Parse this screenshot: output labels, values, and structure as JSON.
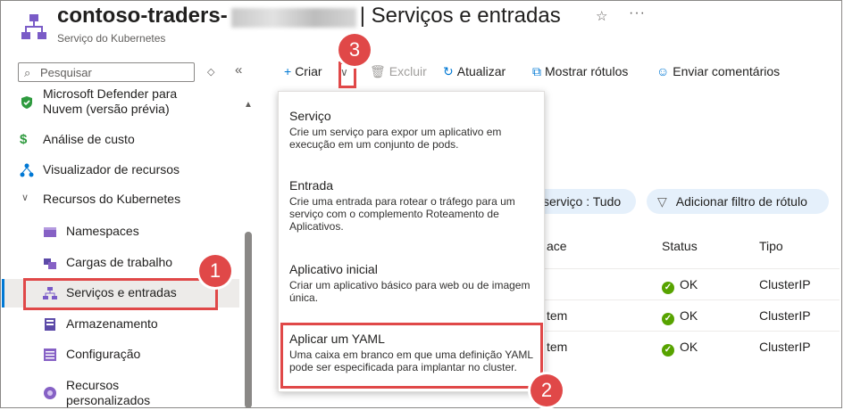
{
  "header": {
    "title_prefix": "contoso-traders-",
    "title_separator": "|",
    "page_title": "Serviços e entradas",
    "subtitle": "Serviço do Kubernetes"
  },
  "sidebar": {
    "search_placeholder": "Pesquisar",
    "items": [
      {
        "label": "Microsoft Defender para Nuvem (versão prévia)",
        "icon": "shield-icon"
      },
      {
        "label": "Análise de custo",
        "icon": "cost-icon"
      },
      {
        "label": "Visualizador de recursos",
        "icon": "resource-visualizer-icon"
      },
      {
        "label": "Recursos do Kubernetes",
        "icon": "chevron-down-icon"
      },
      {
        "label": "Namespaces",
        "icon": "namespace-icon"
      },
      {
        "label": "Cargas de trabalho",
        "icon": "workloads-icon"
      },
      {
        "label": "Serviços e entradas",
        "icon": "services-icon",
        "selected": true
      },
      {
        "label": "Armazenamento",
        "icon": "storage-icon"
      },
      {
        "label": "Configuração",
        "icon": "configuration-icon"
      },
      {
        "label": "Recursos personalizados",
        "icon": "custom-resources-icon"
      }
    ]
  },
  "toolbar": {
    "create": "Criar",
    "delete": "Excluir",
    "refresh": "Atualizar",
    "show_labels": "Mostrar rótulos",
    "feedback": "Enviar comentários"
  },
  "menu": [
    {
      "title": "Serviço",
      "description": "Crie um serviço para expor um aplicativo em execução em um conjunto de pods."
    },
    {
      "title": "Entrada",
      "description": "Crie uma entrada para rotear o tráfego para um serviço com o complemento Roteamento de Aplicativos."
    },
    {
      "title": "Aplicativo inicial",
      "description": "Criar um aplicativo básico para web ou de imagem única."
    },
    {
      "title": "Aplicar um YAML",
      "description": "Uma caixa em branco em que uma definição YAML pode ser especificada para implantar no cluster."
    }
  ],
  "filters": {
    "service_filter": "serviço : Tudo",
    "add_label_filter": "Adicionar filtro de rótulo"
  },
  "table": {
    "headers": [
      "ace",
      "Status",
      "Tipo"
    ],
    "rows": [
      {
        "namespace": "",
        "status": "OK",
        "type": "ClusterIP"
      },
      {
        "namespace": "tem",
        "status": "OK",
        "type": "ClusterIP"
      },
      {
        "namespace": "tem",
        "status": "OK",
        "type": "ClusterIP"
      }
    ]
  },
  "callouts": [
    "1",
    "2",
    "3"
  ],
  "colors": {
    "accent": "#0078d4",
    "callout": "#e04848",
    "ok": "#57a300"
  }
}
